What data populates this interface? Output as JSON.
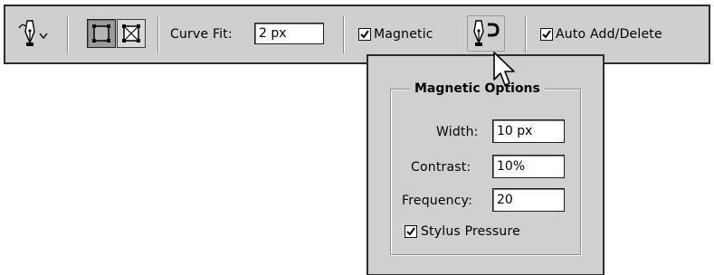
{
  "toolbar": {
    "curve_fit_label": "Curve Fit:",
    "curve_fit_value": "2 px",
    "magnetic_label": "Magnetic",
    "magnetic_checked": true,
    "auto_add_delete_label": "Auto Add/Delete",
    "auto_add_delete_checked": true,
    "tool_icon": "freeform-pen-icon",
    "mode_buttons": [
      {
        "name": "shape-layers-icon",
        "active": true
      },
      {
        "name": "paths-icon",
        "active": false
      }
    ]
  },
  "popup": {
    "title": "Magnetic Options",
    "width_label": "Width:",
    "width_value": "10 px",
    "contrast_label": "Contrast:",
    "contrast_value": "10%",
    "frequency_label": "Frequency:",
    "frequency_value": "20",
    "stylus_label": "Stylus Pressure",
    "stylus_checked": true
  },
  "colors": {
    "toolbar_bg": "#cfcfcf",
    "border": "#2c2c2c",
    "active_button": "#9a9a9a"
  }
}
